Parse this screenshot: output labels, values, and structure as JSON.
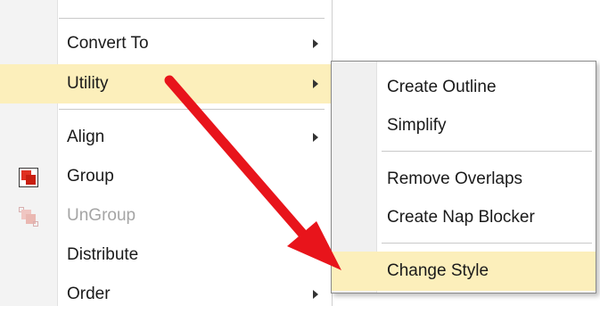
{
  "main_menu": {
    "items": [
      {
        "label": "Convert To",
        "has_submenu": true
      },
      {
        "label": "Utility",
        "has_submenu": true,
        "highlighted": true
      },
      {
        "label": "Align",
        "has_submenu": true
      },
      {
        "label": "Group",
        "icon": "group-icon"
      },
      {
        "label": "UnGroup",
        "icon": "ungroup-icon",
        "disabled": true
      },
      {
        "label": "Distribute"
      },
      {
        "label": "Order",
        "has_submenu": true
      }
    ]
  },
  "submenu": {
    "items": [
      {
        "label": "Create Outline"
      },
      {
        "label": "Simplify"
      },
      {
        "label": "Remove Overlaps"
      },
      {
        "label": "Create Nap Blocker"
      },
      {
        "label": "Change Style",
        "highlighted": true
      }
    ]
  },
  "colors": {
    "highlight": "#fcefbb",
    "annotation_arrow": "#e8141b",
    "group_icon": "#e03020"
  }
}
